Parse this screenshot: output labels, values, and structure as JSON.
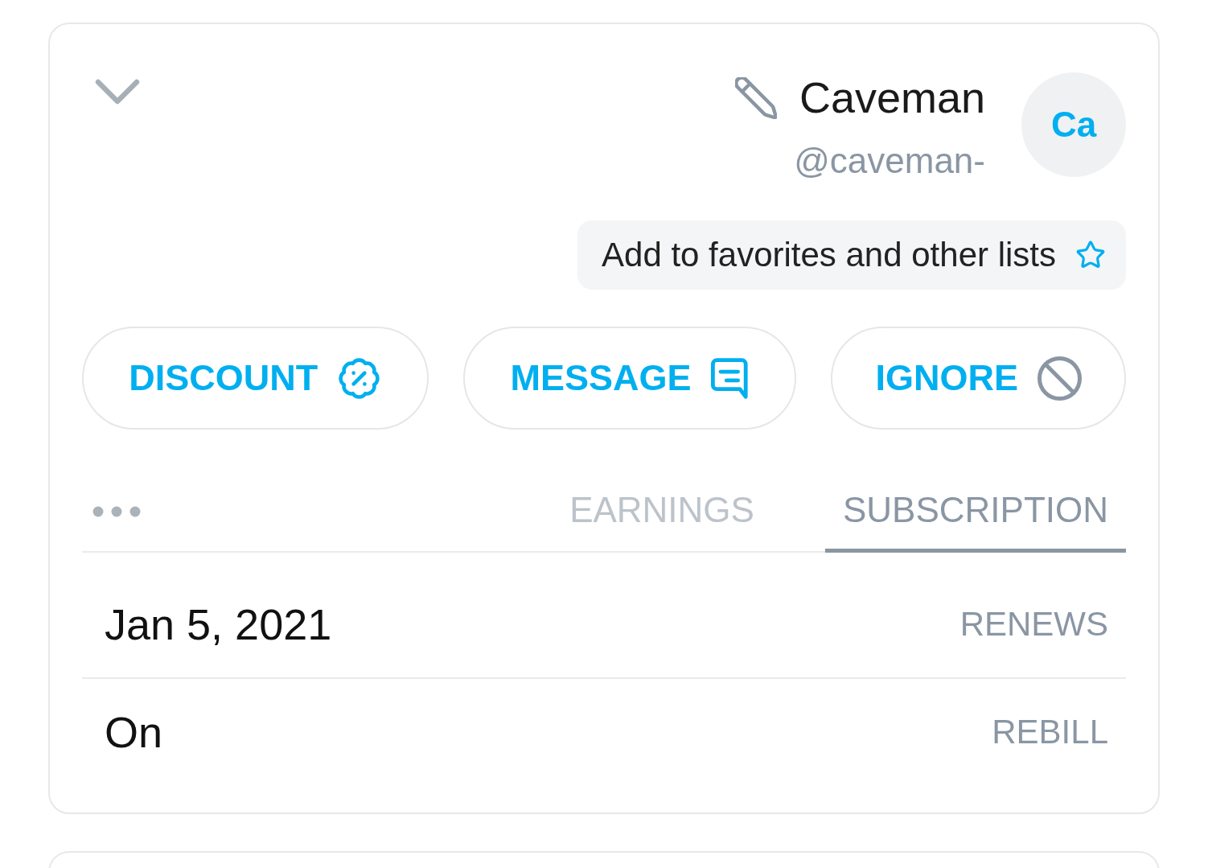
{
  "profile": {
    "initials": "Ca",
    "name": "Caveman",
    "handle": "@caveman-"
  },
  "favorites_button": {
    "label": "Add to favorites and other lists"
  },
  "actions": [
    {
      "kind": "discount",
      "label": "DISCOUNT"
    },
    {
      "kind": "message",
      "label": "MESSAGE"
    },
    {
      "kind": "ignore",
      "label": "IGNORE"
    }
  ],
  "tabs": [
    {
      "label": "EARNINGS",
      "selected": false
    },
    {
      "label": "SUBSCRIPTION",
      "selected": true
    }
  ],
  "details": [
    {
      "label": "RENEWS",
      "value": "Jan 5, 2021"
    },
    {
      "label": "REBILL",
      "value": "On"
    }
  ]
}
